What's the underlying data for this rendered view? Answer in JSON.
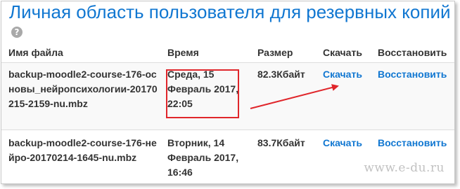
{
  "heading": {
    "title": "Личная область пользователя для резервных копий",
    "help_icon": "question-circle-icon",
    "help_glyph": "?"
  },
  "table": {
    "columns": [
      "Имя файла",
      "Время",
      "Размер",
      "Скачать",
      "Восстановить"
    ],
    "rows": [
      {
        "filename": "backup-moodle2-course-176-основы_нейропсихологии-20170215-2159-nu.mbz",
        "time": "Среда, 15 Февраль 2017, 22:05",
        "size": "82.3Кбайт",
        "download": "Скачать",
        "restore": "Восстановить"
      },
      {
        "filename": "backup-moodle2-course-176-нейро-20170214-1645-nu.mbz",
        "time": "Вторник, 14 Февраль 2017, 16:46",
        "size": "83.7Кбайт",
        "download": "Скачать",
        "restore": "Восстановить"
      }
    ]
  },
  "annotation": {
    "color": "#e0262b"
  },
  "colors": {
    "link": "#1177d1",
    "heading": "#1177d1"
  },
  "watermark": "www.e-du.ru"
}
